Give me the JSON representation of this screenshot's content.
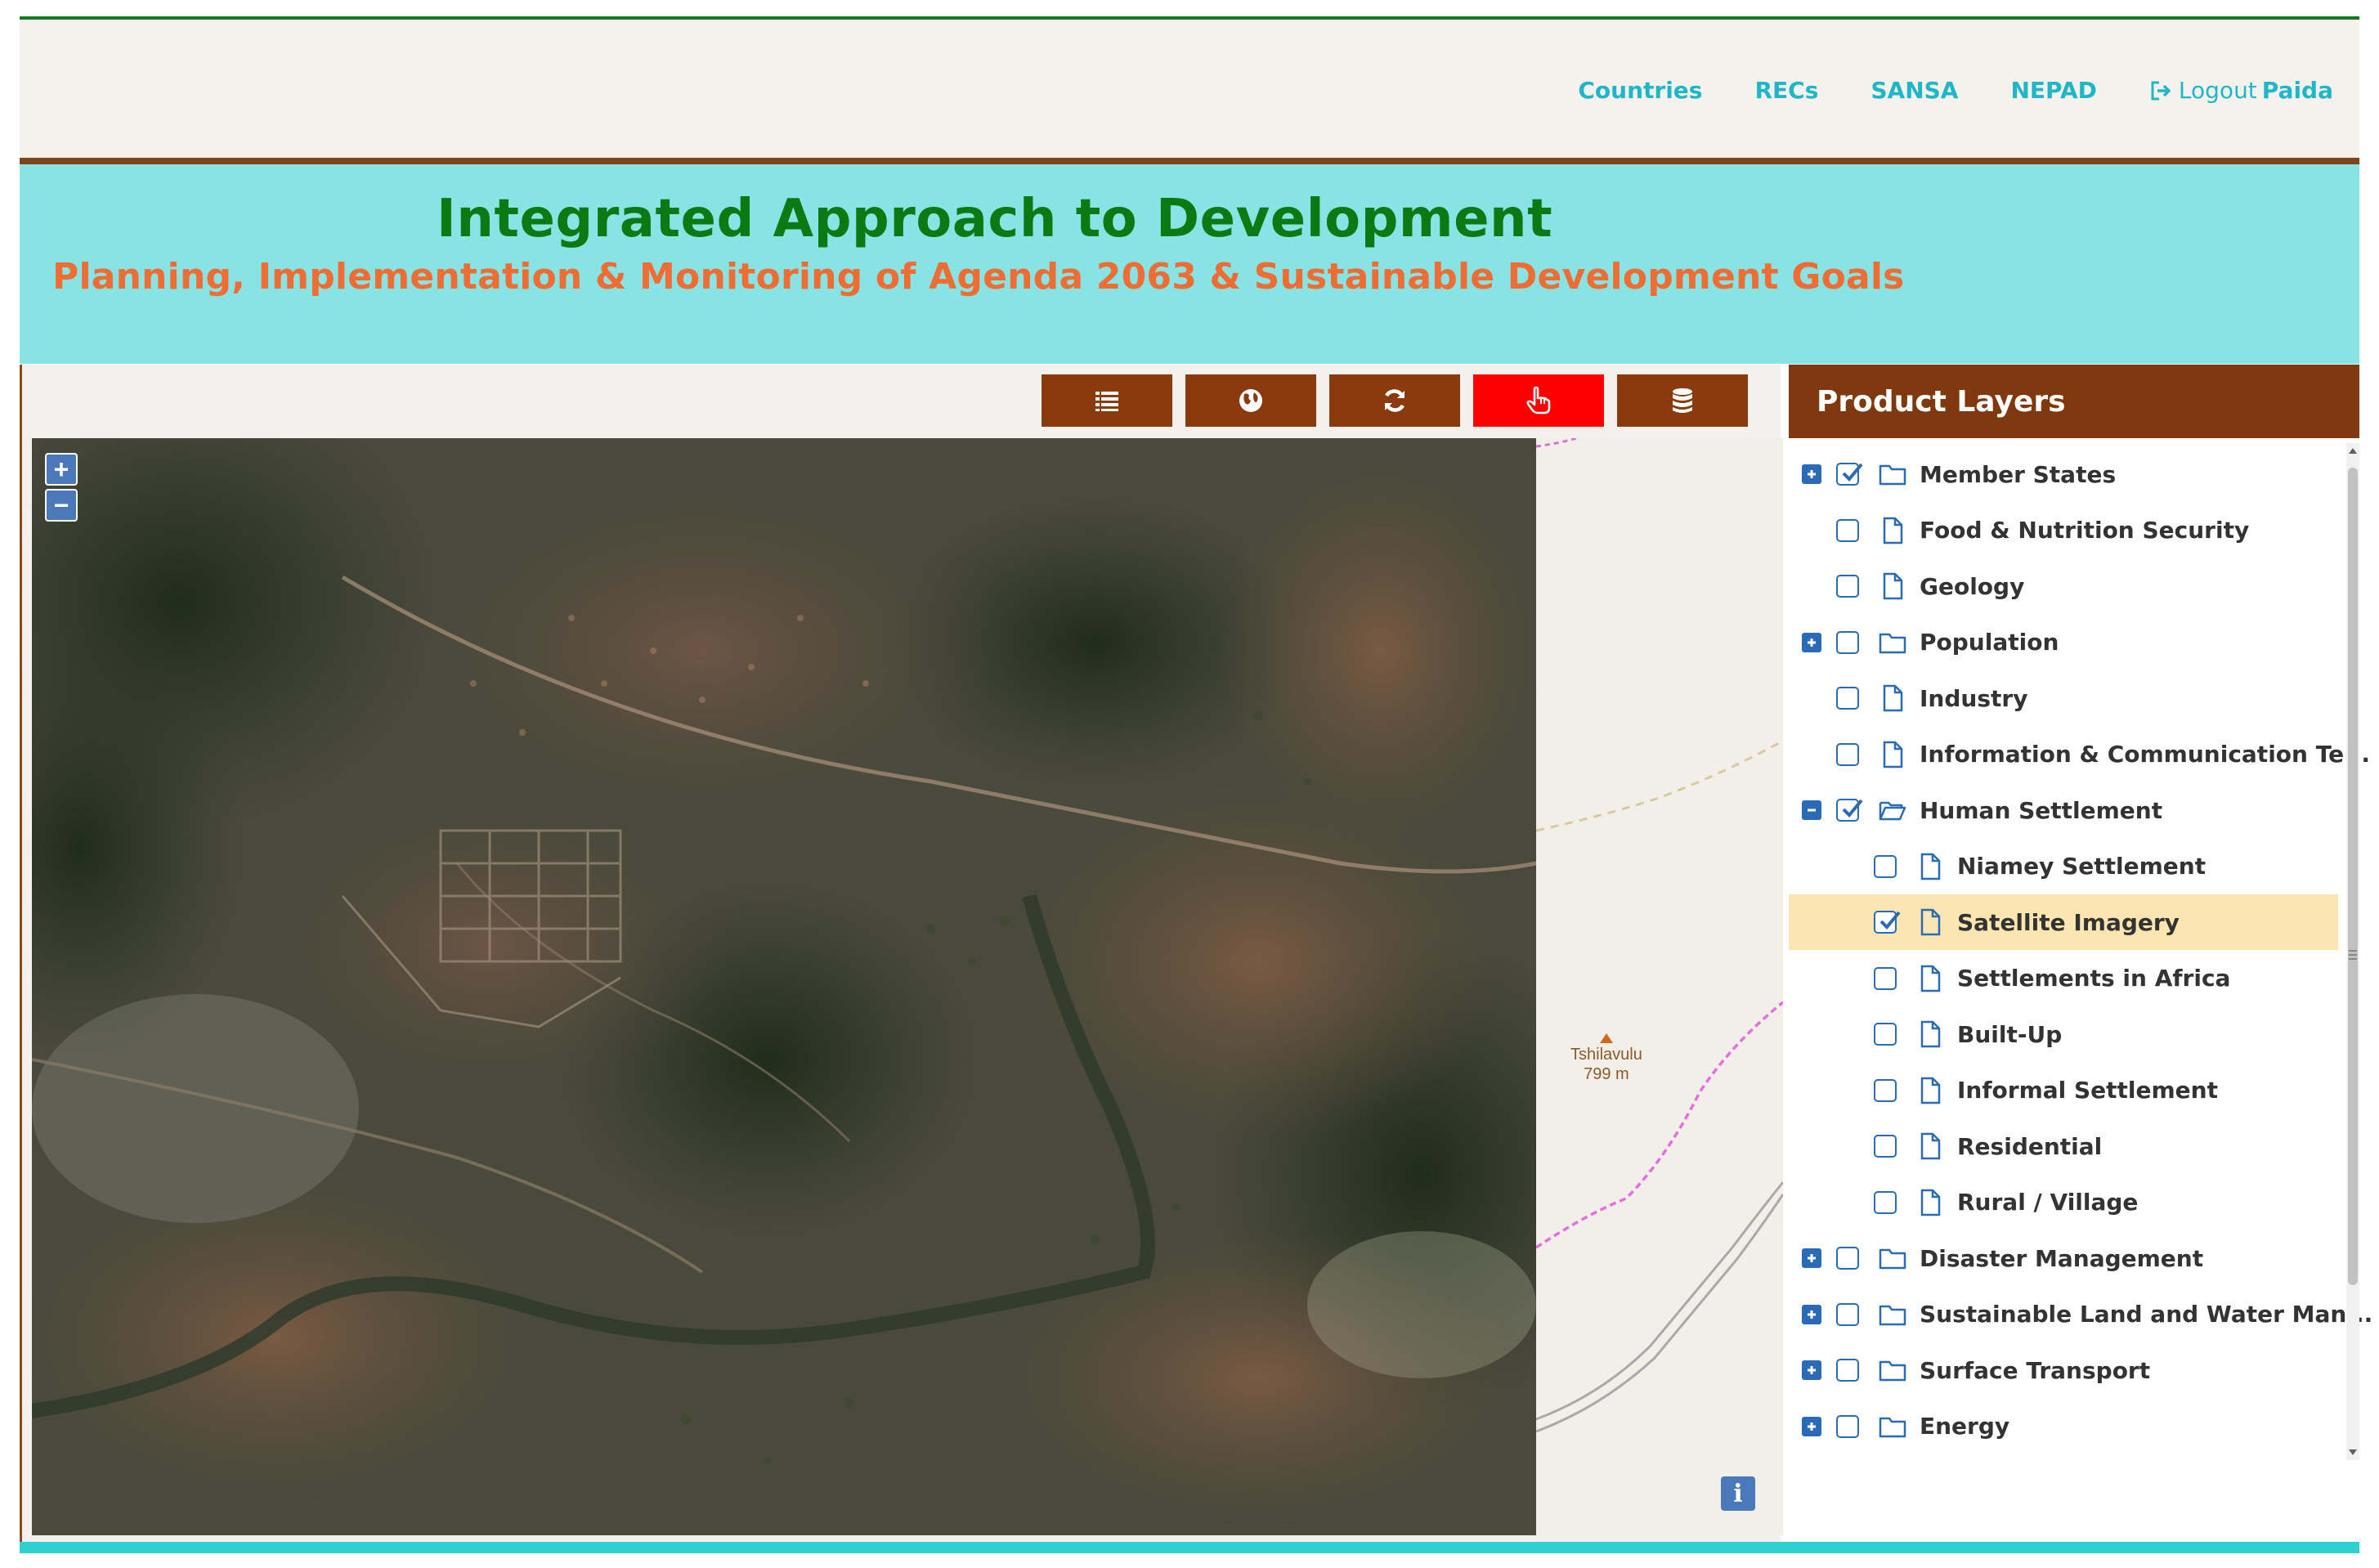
{
  "nav": {
    "links": [
      "Countries",
      "RECs",
      "SANSA",
      "NEPAD"
    ],
    "logout_label": "Logout",
    "user_name": "Paida"
  },
  "banner": {
    "title": "Integrated Approach to Development",
    "subtitle": "Planning, Implementation & Monitoring of Agenda 2063 & Sustainable Development Goals"
  },
  "toolbar": {
    "buttons": [
      {
        "icon": "list-icon",
        "active": false
      },
      {
        "icon": "globe-icon",
        "active": false
      },
      {
        "icon": "refresh-icon",
        "active": false
      },
      {
        "icon": "pointer-hand-icon",
        "active": true
      },
      {
        "icon": "database-icon",
        "active": false
      }
    ]
  },
  "map": {
    "zoom_in_label": "+",
    "zoom_out_label": "−",
    "peak_name": "Tshilavulu",
    "peak_elevation": "799 m",
    "info_label": "i"
  },
  "panel": {
    "title": "Product Layers",
    "layers": [
      {
        "label": "Member States",
        "expander": "plus",
        "checked": true,
        "icon": "folder-icon",
        "indent": 0
      },
      {
        "label": "Food & Nutrition Security",
        "expander": null,
        "checked": false,
        "icon": "file-icon",
        "indent": 0
      },
      {
        "label": "Geology",
        "expander": null,
        "checked": false,
        "icon": "file-icon",
        "indent": 0
      },
      {
        "label": "Population",
        "expander": "plus",
        "checked": false,
        "icon": "folder-icon",
        "indent": 0
      },
      {
        "label": "Industry",
        "expander": null,
        "checked": false,
        "icon": "file-icon",
        "indent": 0
      },
      {
        "label": "Information & Communication Te...",
        "expander": null,
        "checked": false,
        "icon": "file-icon",
        "indent": 0
      },
      {
        "label": "Human Settlement",
        "expander": "minus",
        "checked": true,
        "icon": "folder-open-icon",
        "indent": 0
      },
      {
        "label": "Niamey Settlement",
        "expander": null,
        "checked": false,
        "icon": "file-icon",
        "indent": 1
      },
      {
        "label": "Satellite Imagery",
        "expander": null,
        "checked": true,
        "icon": "file-icon",
        "indent": 1,
        "selected": true
      },
      {
        "label": "Settlements in Africa",
        "expander": null,
        "checked": false,
        "icon": "file-icon",
        "indent": 1
      },
      {
        "label": "Built-Up",
        "expander": null,
        "checked": false,
        "icon": "file-icon",
        "indent": 1
      },
      {
        "label": "Informal Settlement",
        "expander": null,
        "checked": false,
        "icon": "file-icon",
        "indent": 1
      },
      {
        "label": "Residential",
        "expander": null,
        "checked": false,
        "icon": "file-icon",
        "indent": 1
      },
      {
        "label": "Rural / Village",
        "expander": null,
        "checked": false,
        "icon": "file-icon",
        "indent": 1
      },
      {
        "label": "Disaster Management",
        "expander": "plus",
        "checked": false,
        "icon": "folder-icon",
        "indent": 0
      },
      {
        "label": "Sustainable Land and Water Man...",
        "expander": "plus",
        "checked": false,
        "icon": "folder-icon",
        "indent": 0
      },
      {
        "label": "Surface Transport",
        "expander": "plus",
        "checked": false,
        "icon": "folder-icon",
        "indent": 0
      },
      {
        "label": "Energy",
        "expander": "plus",
        "checked": false,
        "icon": "folder-icon",
        "indent": 0
      }
    ]
  },
  "colors": {
    "nav_link": "#1fb7c8",
    "title_green": "#0c7a12",
    "subtitle_orange": "#ef6c33",
    "banner_bg": "#88e4e4",
    "brown": "#80390e",
    "active_tool": "#ff0000",
    "selected_row": "#fbe6b1"
  }
}
